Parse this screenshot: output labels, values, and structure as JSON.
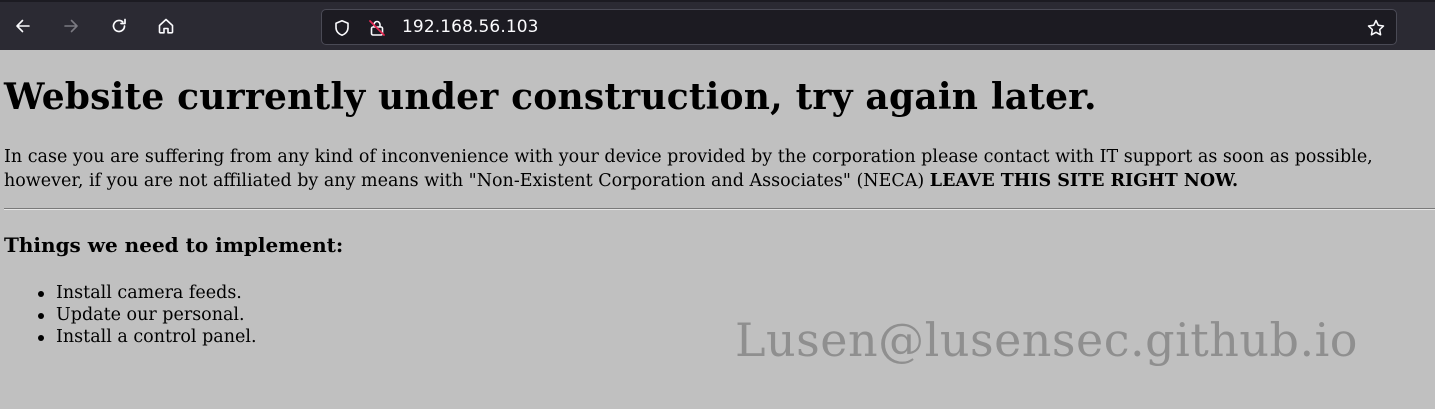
{
  "browser": {
    "url": "192.168.56.103",
    "icons": {
      "back": "arrow-left-icon",
      "forward": "arrow-right-icon",
      "reload": "reload-icon",
      "home": "home-icon",
      "tracking": "shield-icon",
      "insecure": "insecure-lock-icon",
      "bookmark": "star-icon"
    },
    "colors": {
      "toolbar": "#2b2a33",
      "urlbar": "#1c1b22",
      "icon": "#fbfbfe"
    }
  },
  "page": {
    "heading": "Website currently under construction, try again later.",
    "para_line1": "In case you are suffering from any kind of inconvenience with your device provided by the corporation please contact with IT support as soon as possible,",
    "para_line2_prefix": "however, if you are not affiliated by any means with \"Non-Existent Corporation and Associates\" (NECA) ",
    "para_line2_bold": "LEAVE THIS SITE RIGHT NOW.",
    "subheading": "Things we need to implement:",
    "items": [
      "Install camera feeds.",
      "Update our personal.",
      "Install a control panel."
    ],
    "background": "#c0c0c0"
  },
  "watermark": "Lusen@lusensec.github.io"
}
